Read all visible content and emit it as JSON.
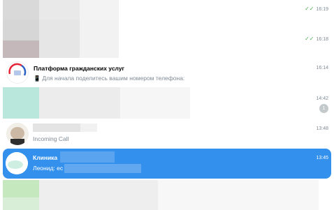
{
  "chat_list": {
    "items": [
      {
        "time": "16:19",
        "read": true
      },
      {
        "time": "16:18",
        "read": true
      },
      {
        "title": "Платформа гражданских услуг",
        "time": "16:14",
        "preview": "Для начала поделитесь вашим номером телефона:",
        "icon": "phone-icon"
      },
      {
        "time": "14:42",
        "unread": "1"
      },
      {
        "time": "13:48",
        "preview": "Incoming Call"
      },
      {
        "title": "Клиника",
        "time": "13:45",
        "preview": "Леонид: ес",
        "selected": true
      },
      {}
    ]
  },
  "colors": {
    "selected": "#3390ec",
    "read_check": "#4fae4e",
    "badge": "#c4c9cc"
  }
}
